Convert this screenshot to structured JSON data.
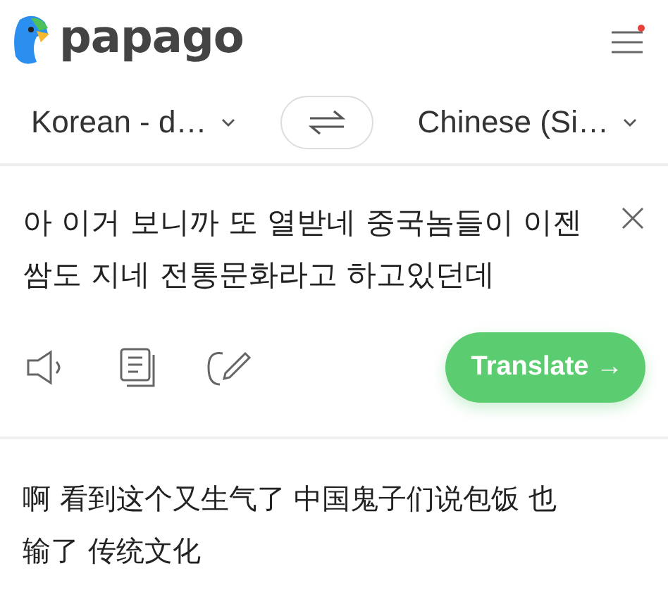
{
  "app": {
    "logo_text": "papago",
    "menu_notification": true
  },
  "languages": {
    "source": "Korean - d…",
    "target": "Chinese (Si…"
  },
  "source": {
    "text": "아 이거 보니까 또 열받네 중국놈들이 이젠 쌈도 지네 전통문화라고 하고있던데",
    "translate_button": "Translate →"
  },
  "result": {
    "text": "啊 看到这个又生气了 中国鬼子们说包饭 也输了 传统文化"
  }
}
